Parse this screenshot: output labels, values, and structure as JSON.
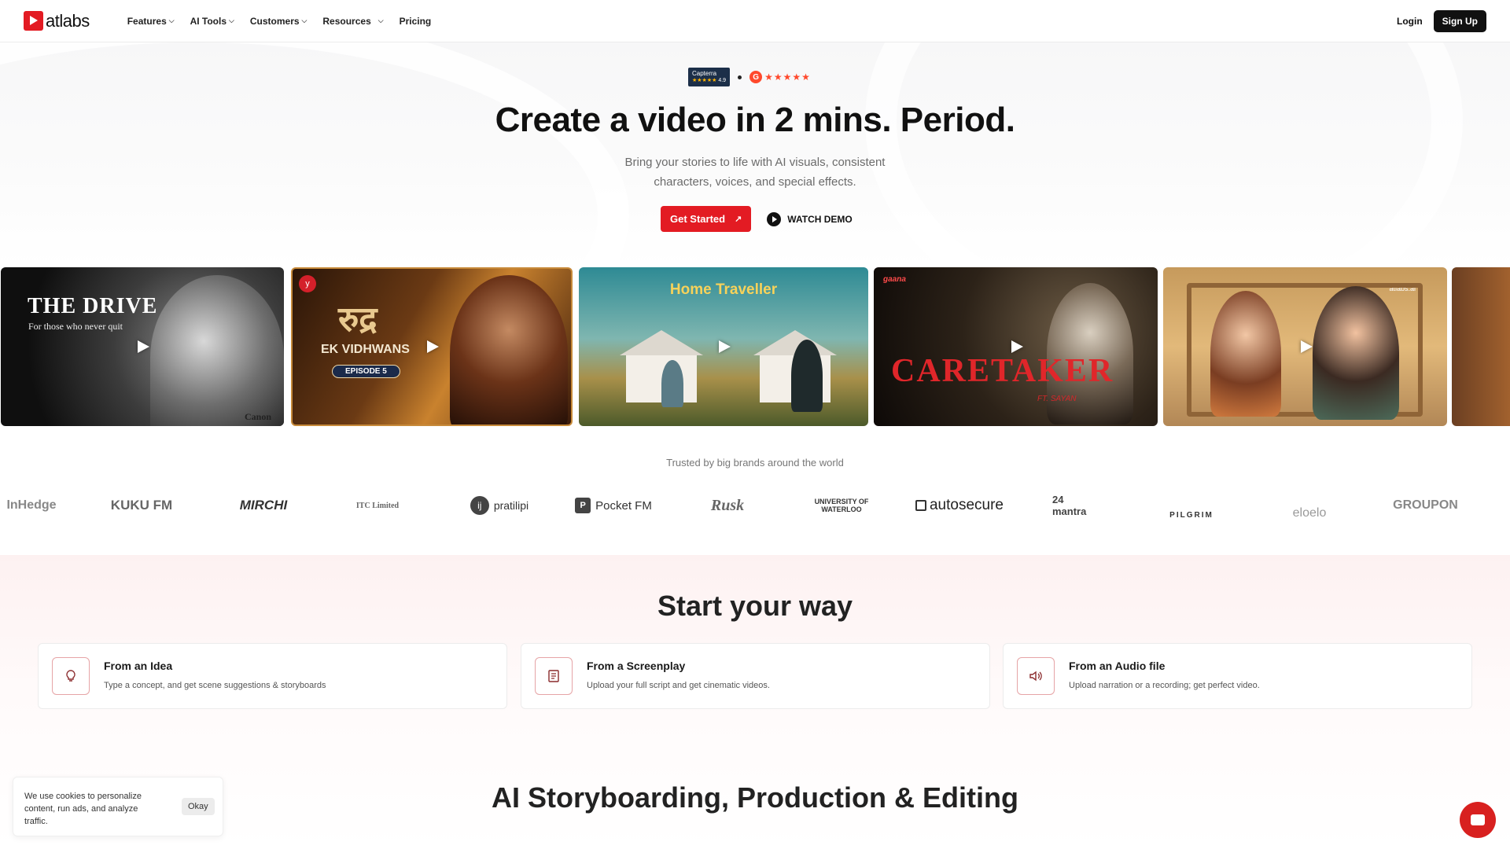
{
  "nav": {
    "logo_text": "atlabs",
    "menu": [
      {
        "label": "Features",
        "has_dropdown": true
      },
      {
        "label": "AI Tools",
        "has_dropdown": true
      },
      {
        "label": "Customers",
        "has_dropdown": true
      },
      {
        "label": "Resources",
        "has_dropdown": true
      },
      {
        "label": "Pricing",
        "has_dropdown": false
      }
    ],
    "login_label": "Login",
    "signup_label": "Sign Up"
  },
  "hero": {
    "capterra_label": "Capterra",
    "capterra_score": "4.9",
    "g2_label": "G",
    "g2_stars": "★★★★★",
    "title": "Create a video in 2 mins. Period.",
    "subtitle": "Bring your stories to life with AI visuals, consistent characters, voices, and special effects.",
    "cta_primary": "Get Started",
    "cta_secondary": "WATCH DEMO"
  },
  "videos": [
    {
      "title": "THE DRIVE",
      "subtitle": "For those who never quit",
      "corner": "Canon"
    },
    {
      "title": "रुद्र",
      "subtitle": "EK VIDHWANS",
      "badge": "EPISODE 5"
    },
    {
      "title": "Home Traveller"
    },
    {
      "title": "CARETAKER",
      "subtitle": "FT. SAYAN",
      "corner": "gaana"
    },
    {
      "title": "",
      "corner": "atlabs.ai"
    },
    {
      "title": ""
    }
  ],
  "brands_heading": "Trusted by big brands around the world",
  "brands": [
    "InHedge",
    "KUKU FM",
    "MIRCHI",
    "ITC Limited",
    "pratilipi",
    "Pocket FM",
    "Rusk",
    "UNIVERSITY OF WATERLOO",
    "autosecure",
    "24 mantra",
    "PILGRIM",
    "eloelo",
    "GROUPON"
  ],
  "start": {
    "title": "Start your way",
    "options": [
      {
        "title": "From an Idea",
        "desc": "Type a concept, and get scene suggestions & storyboards",
        "icon": "lightbulb-icon"
      },
      {
        "title": "From a Screenplay",
        "desc": "Upload your full script and get cinematic videos.",
        "icon": "script-icon"
      },
      {
        "title": "From an Audio file",
        "desc": "Upload narration or a recording; get perfect video.",
        "icon": "speaker-icon"
      }
    ]
  },
  "section2_title": "AI Storyboarding, Production & Editing",
  "cookie": {
    "text": "We use cookies to personalize content, run ads, and analyze traffic.",
    "button": "Okay"
  },
  "colors": {
    "accent": "#e31b23",
    "dark": "#111111"
  }
}
